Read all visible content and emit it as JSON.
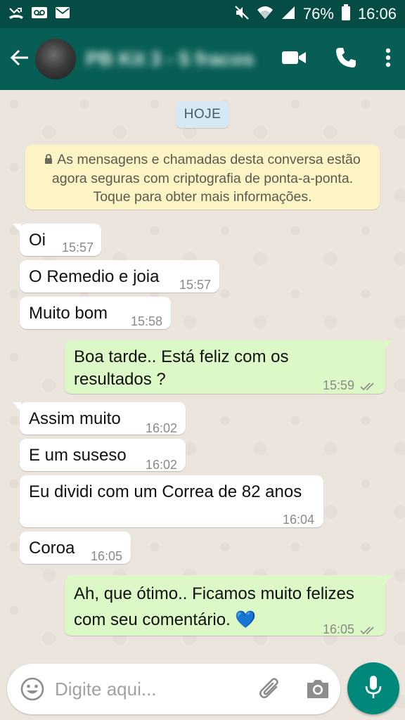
{
  "status_bar": {
    "battery_percent": "76%",
    "time": "16:06",
    "icons": [
      "missed-call-icon",
      "voicemail-icon",
      "email-icon",
      "mute-icon",
      "wifi-icon",
      "signal-icon",
      "battery-icon"
    ]
  },
  "header": {
    "contact_name": "PB Kit 3 - 5 fracos",
    "icons": [
      "back-arrow-icon",
      "video-call-icon",
      "voice-call-icon",
      "more-options-icon"
    ]
  },
  "chat": {
    "date_chip": "HOJE",
    "encryption_notice": "As mensagens e chamadas desta conversa estão agora seguras com criptografia de ponta-a-ponta. Toque para obter mais informações.",
    "messages": [
      {
        "direction": "in",
        "text": "Oi",
        "time": "15:57"
      },
      {
        "direction": "in",
        "text": "O Remedio e joia",
        "time": "15:57"
      },
      {
        "direction": "in",
        "text": "Muito bom",
        "time": "15:58"
      },
      {
        "direction": "out",
        "text": "Boa tarde.. Está feliz com os resultados ?",
        "time": "15:59",
        "status": "read"
      },
      {
        "direction": "in",
        "text": "Assim muito",
        "time": "16:02"
      },
      {
        "direction": "in",
        "text": "E um suseso",
        "time": "16:02"
      },
      {
        "direction": "in",
        "text": "Eu dividi com um Correa de 82 anos",
        "time": "16:04"
      },
      {
        "direction": "in",
        "text": "Coroa",
        "time": "16:05"
      },
      {
        "direction": "out",
        "text": "Ah, que ótimo.. Ficamos muito felizes com seu comentário. 💙",
        "time": "16:05",
        "status": "read"
      }
    ]
  },
  "composer": {
    "placeholder": "Digite aqui...",
    "icons": [
      "emoji-icon",
      "attach-icon",
      "camera-icon",
      "microphone-icon"
    ]
  },
  "colors": {
    "header": "#075e54",
    "status_bar": "#054d44",
    "incoming_bubble": "#ffffff",
    "outgoing_bubble": "#dcf8c6",
    "mic_button": "#00897b",
    "read_ticks": "#8a8a8a"
  }
}
